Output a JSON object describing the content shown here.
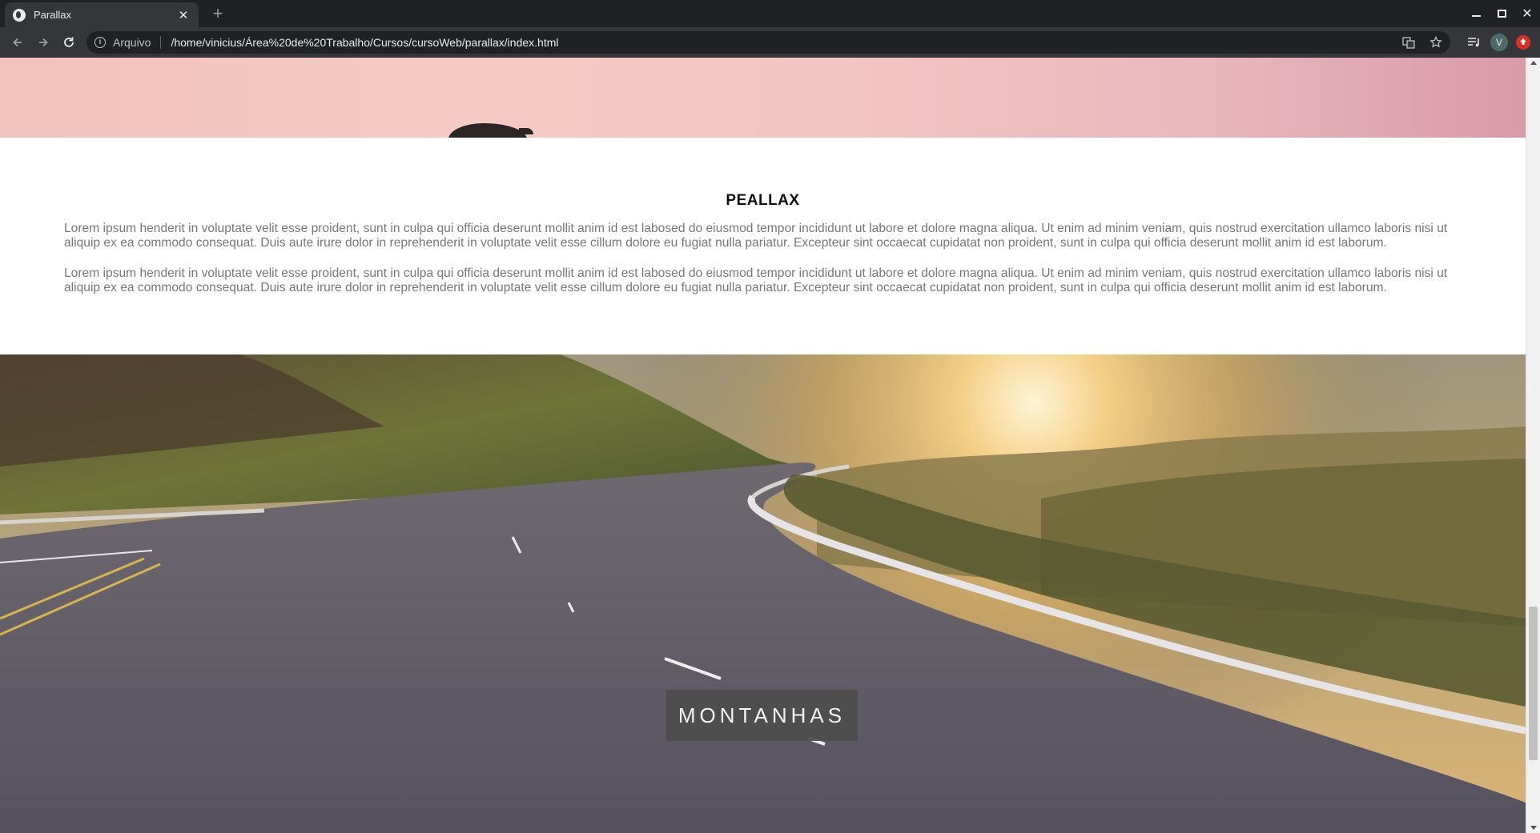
{
  "browser": {
    "tab_title": "Parallax",
    "scheme_label": "Arquivo",
    "url": "/home/vinicius/Área%20de%20Trabalho/Cursos/cursoWeb/parallax/index.html",
    "avatar_letter": "V"
  },
  "page": {
    "section_title": "PEALLAX",
    "paragraphs": [
      "Lorem ipsum henderit in voluptate velit esse proident, sunt in culpa qui officia deserunt mollit anim id est labosed do eiusmod tempor incididunt ut labore et dolore magna aliqua. Ut enim ad minim veniam, quis nostrud exercitation ullamco laboris nisi ut aliquip ex ea commodo consequat. Duis aute irure dolor in reprehenderit in voluptate velit esse cillum dolore eu fugiat nulla pariatur. Excepteur sint occaecat cupidatat non proident, sunt in culpa qui officia deserunt mollit anim id est laborum.",
      "Lorem ipsum henderit in voluptate velit esse proident, sunt in culpa qui officia deserunt mollit anim id est labosed do eiusmod tempor incididunt ut labore et dolore magna aliqua. Ut enim ad minim veniam, quis nostrud exercitation ullamco laboris nisi ut aliquip ex ea commodo consequat. Duis aute irure dolor in reprehenderit in voluptate velit esse cillum dolore eu fugiat nulla pariatur. Excepteur sint occaecat cupidatat non proident, sunt in culpa qui officia deserunt mollit anim id est laborum."
    ],
    "badge_label": "MONTANHAS"
  },
  "icons": {
    "back": "arrow-back-icon",
    "forward": "arrow-forward-icon",
    "reload": "reload-icon",
    "info": "info-icon",
    "translate": "translate-icon",
    "bookmark": "star-icon",
    "media": "media-queue-icon"
  },
  "colors": {
    "chrome_dark": "#202124",
    "chrome_toolbar": "#35363a",
    "badge_bg": "#4d4d4d",
    "body_text": "#777777"
  }
}
